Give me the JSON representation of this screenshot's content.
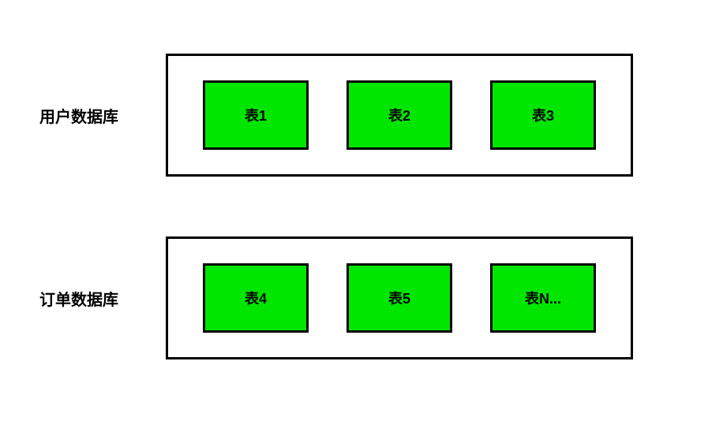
{
  "databases": [
    {
      "label": "用户数据库",
      "tables": [
        "表1",
        "表2",
        "表3"
      ]
    },
    {
      "label": "订单数据库",
      "tables": [
        "表4",
        "表5",
        "表N..."
      ]
    }
  ]
}
